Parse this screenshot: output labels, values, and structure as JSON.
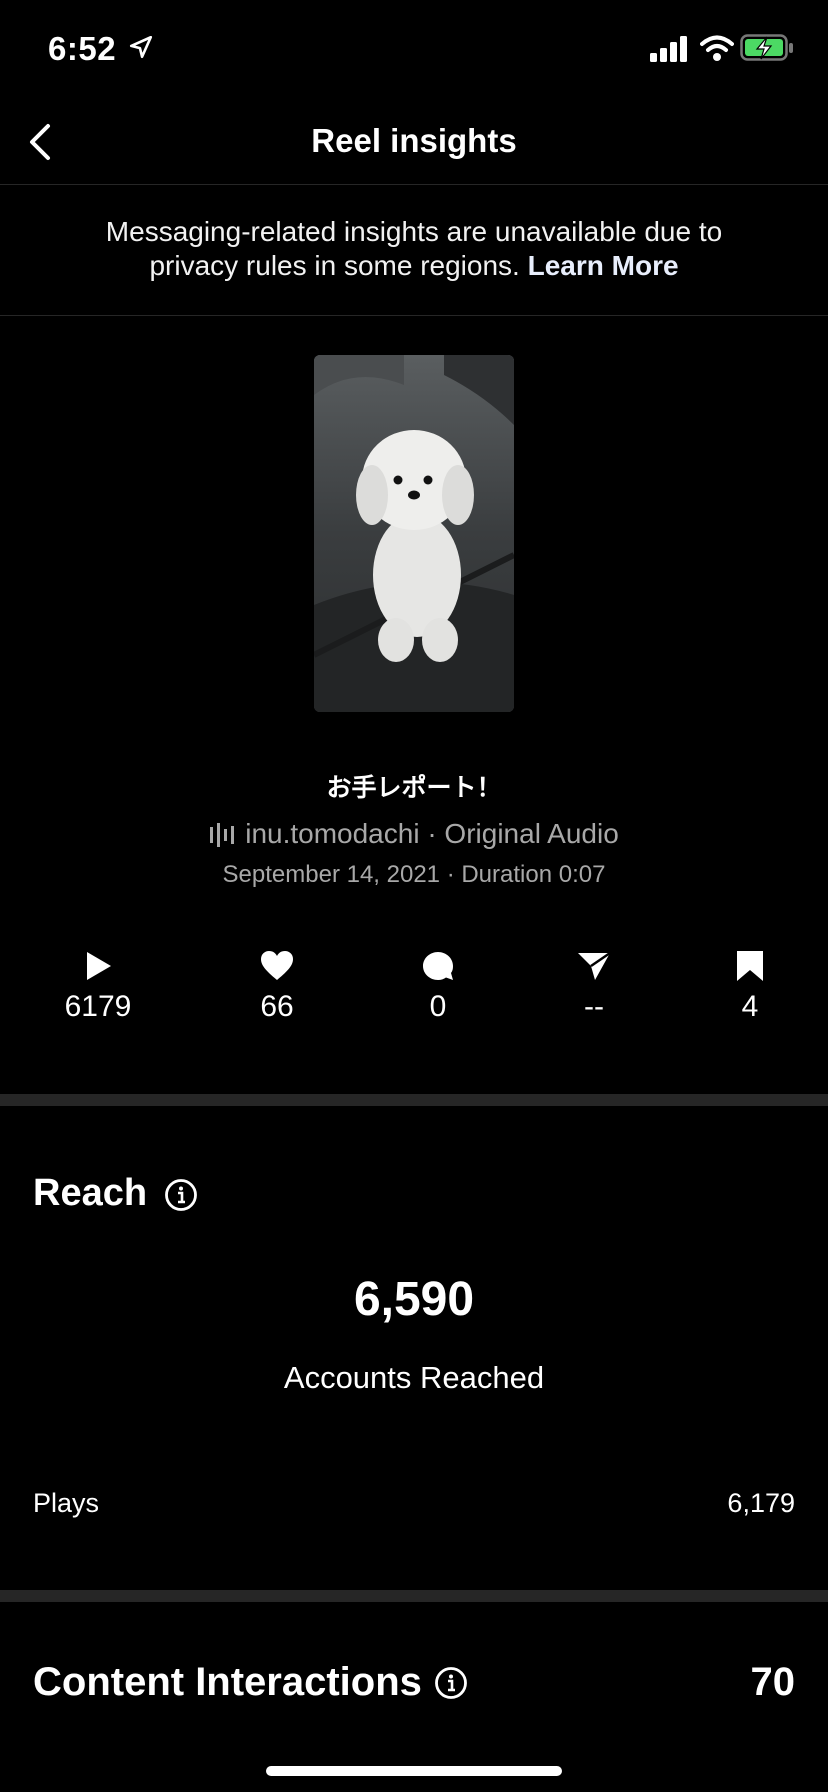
{
  "status_bar": {
    "time": "6:52"
  },
  "header": {
    "title": "Reel insights"
  },
  "notice": {
    "text": "Messaging-related insights are unavailable due to privacy rules in some regions.",
    "link": "Learn More"
  },
  "post": {
    "caption": "お手レポート！",
    "audio": "inu.tomodachi · Original Audio",
    "meta": "September 14, 2021 · Duration 0:07"
  },
  "stats": {
    "plays": "6179",
    "likes": "66",
    "comments": "0",
    "shares": "--",
    "saves": "4"
  },
  "reach": {
    "title": "Reach",
    "value": "6,590",
    "label": "Accounts Reached",
    "plays_label": "Plays",
    "plays_value": "6,179"
  },
  "interactions": {
    "title": "Content Interactions",
    "value": "70"
  }
}
